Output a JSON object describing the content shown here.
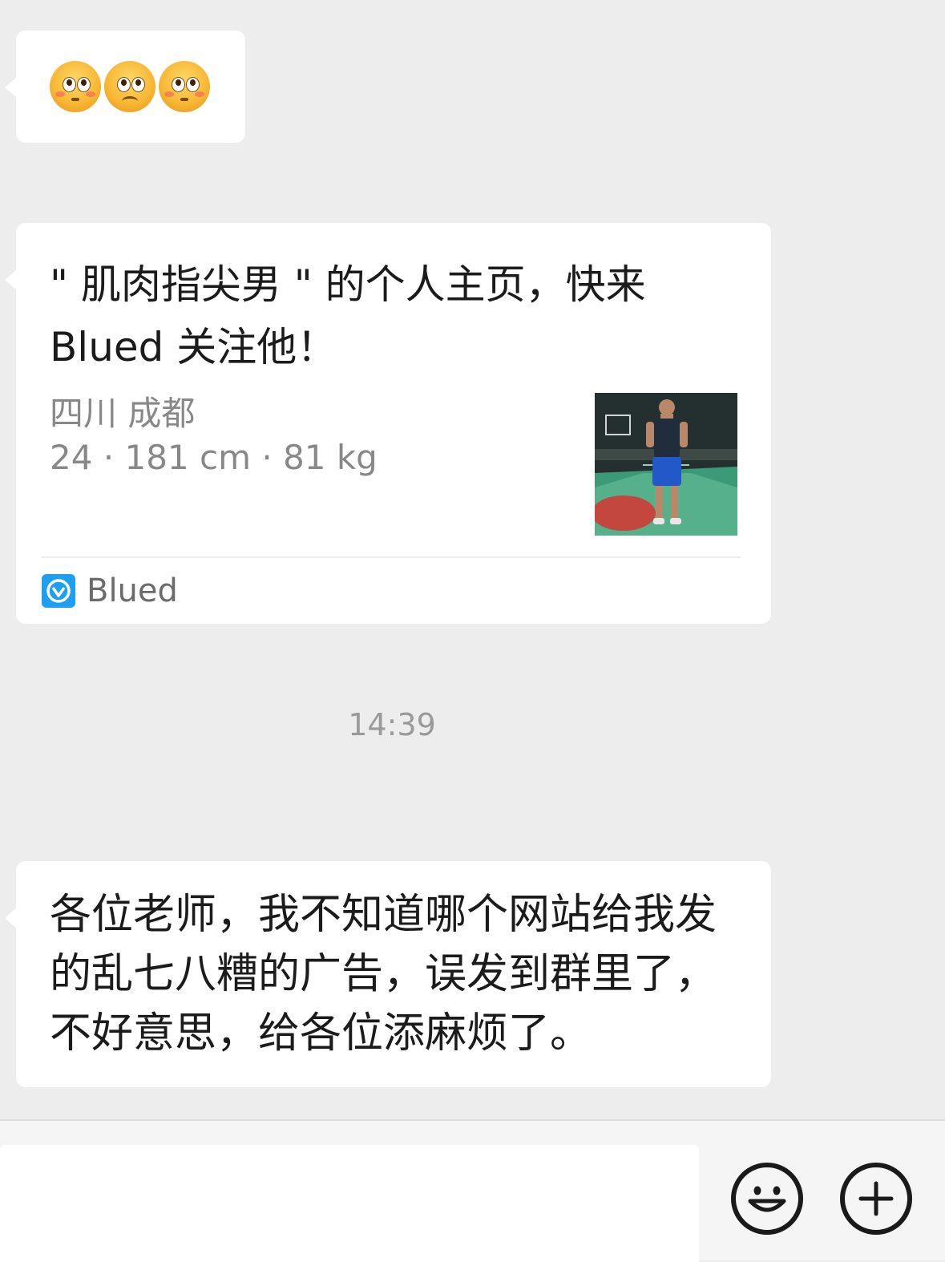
{
  "messages": {
    "emoji_message": {
      "emojis": [
        "flushed-face-emoji",
        "frowning-face-emoji",
        "flushed-face-emoji"
      ]
    },
    "link_card": {
      "title": "\" 肌肉指尖男 \" 的个人主页，快来Blued 关注他！",
      "location": "四川 成都",
      "stats": "24 · 181 cm · 81 kg",
      "source_name": "Blued",
      "source_color": "#1e9ff2"
    },
    "timestamp": "14:39",
    "text_message": "各位老师，我不知道哪个网站给我发的乱七八糟的广告，误发到群里了，不好意思，给各位添麻烦了。"
  },
  "input_bar": {
    "value": "",
    "emoji_button": "smiley-icon",
    "more_button": "plus-icon"
  },
  "colors": {
    "chat_background": "#ededed",
    "bubble": "#ffffff",
    "secondary_text": "#888888"
  }
}
